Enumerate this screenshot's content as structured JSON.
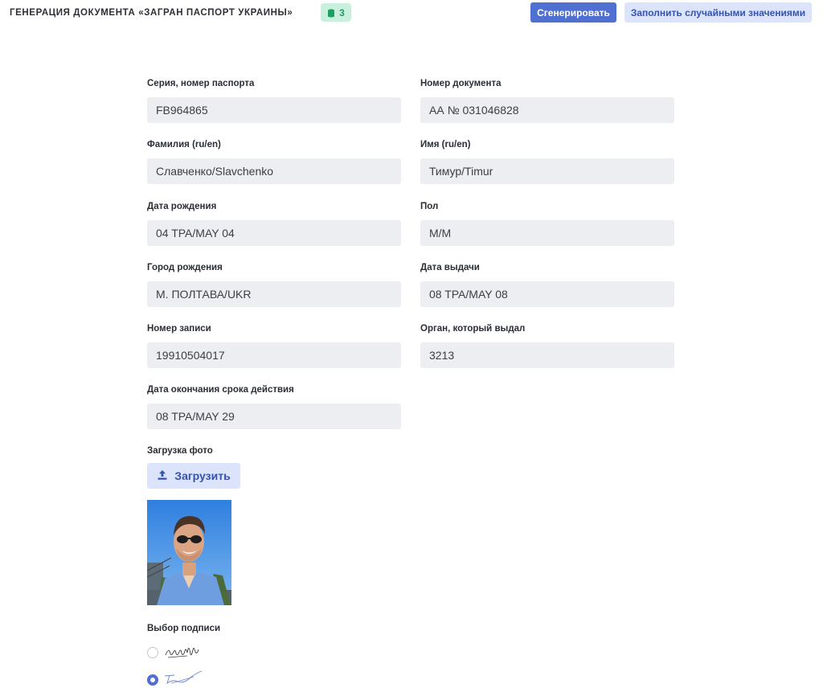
{
  "header": {
    "title": "ГЕНЕРАЦИЯ ДОКУМЕНТА «ЗАГРАН ПАСПОРТ УКРАИНЫ»",
    "coins": "3",
    "generate_label": "Сгенерировать",
    "random_fill_label": "Заполнить случайными значениями"
  },
  "form": {
    "series_number": {
      "label": "Серия, номер паспорта",
      "value": "FB964865"
    },
    "document_number": {
      "label": "Номер документа",
      "value": "АА № 031046828"
    },
    "surname": {
      "label": "Фамилия (ru/en)",
      "value": "Славченко/Slavchenko"
    },
    "name": {
      "label": "Имя (ru/en)",
      "value": "Тимур/Timur"
    },
    "birth_date": {
      "label": "Дата рождения",
      "value": "04 TPA/MAY 04"
    },
    "sex": {
      "label": "Пол",
      "value": "M/M"
    },
    "birth_city": {
      "label": "Город рождения",
      "value": "М. ПОЛТАВА/UKR"
    },
    "issue_date": {
      "label": "Дата выдачи",
      "value": "08 TPA/MAY 08"
    },
    "record_number": {
      "label": "Номер записи",
      "value": "19910504017"
    },
    "authority": {
      "label": "Орган, который выдал",
      "value": "3213"
    },
    "expiry_date": {
      "label": "Дата окончания срока действия",
      "value": "08 TPA/MAY 29"
    }
  },
  "photo": {
    "label": "Загрузка фото",
    "upload_label": "Загрузить"
  },
  "signature": {
    "label": "Выбор подписи",
    "selected_option": 2
  },
  "colors": {
    "primary": "#4f6fd1",
    "secondary_bg": "#dbe4fb",
    "badge_bg": "#c9f0dc",
    "badge_text": "#1f9d63",
    "input_bg": "#eceef1"
  },
  "icons": {
    "coin": "coins-icon",
    "upload": "upload-icon"
  }
}
